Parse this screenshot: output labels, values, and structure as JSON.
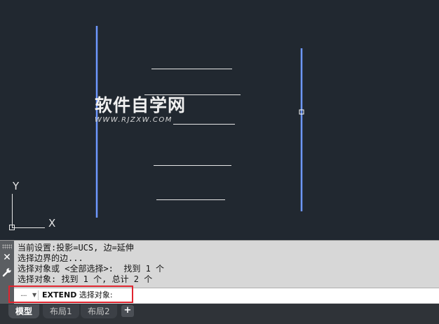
{
  "watermark": {
    "title": "软件自学网",
    "url": "WWW.RJZXW.COM"
  },
  "ucs": {
    "y_label": "Y",
    "x_label": "X"
  },
  "command_window": {
    "history": [
      "当前设置:投影=UCS, 边=延伸",
      "选择边界的边...",
      "选择对象或 <全部选择>:  找到 1 个",
      "选择对象: 找到 1 个, 总计 2 个"
    ],
    "command_name": "EXTEND",
    "prompt_text": " 选择对象:"
  },
  "tabs": [
    {
      "label": "模型",
      "active": true
    },
    {
      "label": "布局1",
      "active": false
    },
    {
      "label": "布局2",
      "active": false
    }
  ],
  "tab_add_label": "+",
  "colors": {
    "canvas_bg": "#212830",
    "selected_line": "#6e98ff",
    "drawing_line": "#e6e6e6",
    "highlight": "#e0252f"
  },
  "icons": {
    "close": "close-icon",
    "customize": "wrench-icon",
    "grip": "grip-icon",
    "recent_commands": "recent-commands-icon"
  }
}
